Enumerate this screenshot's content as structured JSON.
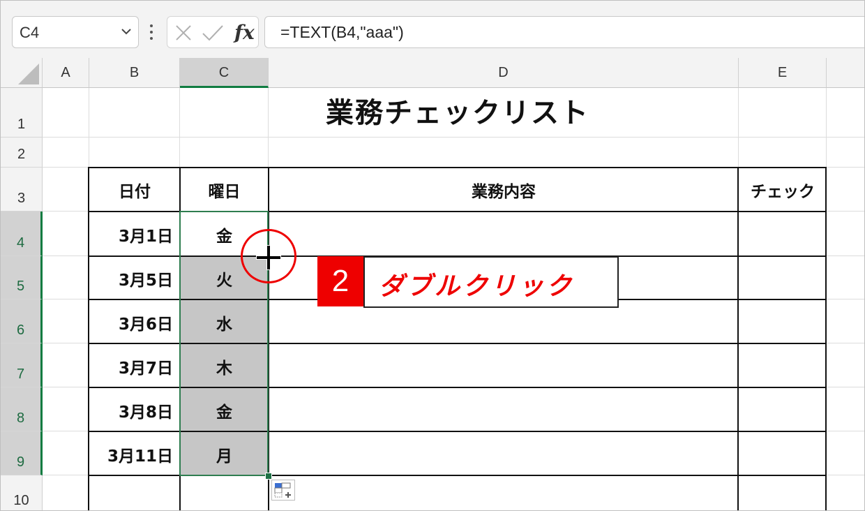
{
  "formula_bar": {
    "name_box": "C4",
    "fx_label": "fx",
    "formula": "=TEXT(B4,\"aaa\")"
  },
  "columns": [
    "A",
    "B",
    "C",
    "D",
    "E"
  ],
  "rows": [
    "1",
    "2",
    "3",
    "4",
    "5",
    "6",
    "7",
    "8",
    "9",
    "10"
  ],
  "sheet": {
    "title": "業務チェックリスト",
    "headers": {
      "date": "日付",
      "weekday": "曜日",
      "task": "業務内容",
      "check": "チェック"
    },
    "data_rows": [
      {
        "date": "3月1日",
        "weekday": "金"
      },
      {
        "date": "3月5日",
        "weekday": "火"
      },
      {
        "date": "3月6日",
        "weekday": "水"
      },
      {
        "date": "3月7日",
        "weekday": "木"
      },
      {
        "date": "3月8日",
        "weekday": "金"
      },
      {
        "date": "3月11日",
        "weekday": "月"
      }
    ]
  },
  "annotation": {
    "step_number": "2",
    "step_text": "ダブルクリック",
    "accent_color": "#e00000"
  },
  "icons": {
    "dropdown": "chevron-down-icon",
    "cancel": "cancel-x-icon",
    "enter": "checkmark-icon",
    "autofill_options": "auto-fill-options-icon",
    "cursor": "fill-handle-crosshair-icon"
  }
}
